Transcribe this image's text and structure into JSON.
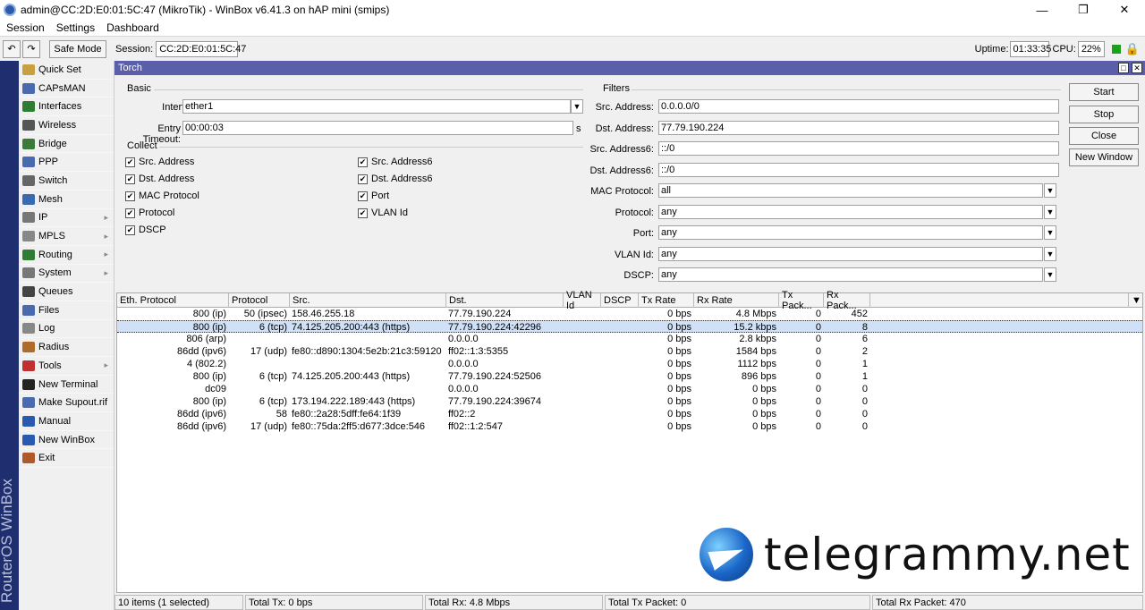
{
  "window": {
    "title": "admin@CC:2D:E0:01:5C:47 (MikroTik) - WinBox v6.41.3 on hAP mini (smips)"
  },
  "menu": [
    "Session",
    "Settings",
    "Dashboard"
  ],
  "toolbar": {
    "safe_mode": "Safe Mode",
    "session_label": "Session:",
    "session_value": "CC:2D:E0:01:5C:47",
    "uptime_label": "Uptime:",
    "uptime_value": "01:33:35",
    "cpu_label": "CPU:",
    "cpu_value": "22%"
  },
  "sidebar": {
    "brand": "RouterOS WinBox",
    "items": [
      {
        "label": "Quick Set",
        "icon": "wand-icon",
        "color": "#c8a040",
        "arrow": false
      },
      {
        "label": "CAPsMAN",
        "icon": "capsman-icon",
        "color": "#4a6ab0",
        "arrow": false
      },
      {
        "label": "Interfaces",
        "icon": "interfaces-icon",
        "color": "#2e7d32",
        "arrow": false
      },
      {
        "label": "Wireless",
        "icon": "wireless-icon",
        "color": "#555555",
        "arrow": false
      },
      {
        "label": "Bridge",
        "icon": "bridge-icon",
        "color": "#3a7a3a",
        "arrow": false
      },
      {
        "label": "PPP",
        "icon": "ppp-icon",
        "color": "#4a6ab0",
        "arrow": false
      },
      {
        "label": "Switch",
        "icon": "switch-icon",
        "color": "#666666",
        "arrow": false
      },
      {
        "label": "Mesh",
        "icon": "mesh-icon",
        "color": "#3a6ab0",
        "arrow": false
      },
      {
        "label": "IP",
        "icon": "ip-icon",
        "color": "#777777",
        "arrow": true
      },
      {
        "label": "MPLS",
        "icon": "mpls-icon",
        "color": "#888888",
        "arrow": true
      },
      {
        "label": "Routing",
        "icon": "routing-icon",
        "color": "#2e7d32",
        "arrow": true
      },
      {
        "label": "System",
        "icon": "system-icon",
        "color": "#777777",
        "arrow": true
      },
      {
        "label": "Queues",
        "icon": "queues-icon",
        "color": "#444444",
        "arrow": false
      },
      {
        "label": "Files",
        "icon": "files-icon",
        "color": "#4a6ab0",
        "arrow": false
      },
      {
        "label": "Log",
        "icon": "log-icon",
        "color": "#888888",
        "arrow": false
      },
      {
        "label": "Radius",
        "icon": "radius-icon",
        "color": "#b06a2a",
        "arrow": false
      },
      {
        "label": "Tools",
        "icon": "tools-icon",
        "color": "#c03030",
        "arrow": true
      },
      {
        "label": "New Terminal",
        "icon": "terminal-icon",
        "color": "#222222",
        "arrow": false
      },
      {
        "label": "Make Supout.rif",
        "icon": "supout-icon",
        "color": "#4a6ab0",
        "arrow": false
      },
      {
        "label": "Manual",
        "icon": "manual-icon",
        "color": "#2a5ab0",
        "arrow": false
      },
      {
        "label": "New WinBox",
        "icon": "winbox-icon",
        "color": "#2a5ab0",
        "arrow": false
      },
      {
        "label": "Exit",
        "icon": "exit-icon",
        "color": "#b05a2a",
        "arrow": false
      }
    ]
  },
  "torch": {
    "title": "Torch",
    "basic_label": "Basic",
    "interface_label": "Interface:",
    "interface_value": "ether1",
    "entry_timeout_label": "Entry Timeout:",
    "entry_timeout_value": "00:00:03",
    "entry_timeout_unit": "s",
    "collect_label": "Collect",
    "collect": [
      {
        "label": "Src. Address",
        "checked": true
      },
      {
        "label": "Dst. Address",
        "checked": true
      },
      {
        "label": "MAC Protocol",
        "checked": true
      },
      {
        "label": "Protocol",
        "checked": true
      },
      {
        "label": "DSCP",
        "checked": true
      },
      {
        "label": "Src. Address6",
        "checked": true
      },
      {
        "label": "Dst. Address6",
        "checked": true
      },
      {
        "label": "Port",
        "checked": true
      },
      {
        "label": "VLAN Id",
        "checked": true
      }
    ],
    "filters_label": "Filters",
    "filters": [
      {
        "label": "Src. Address:",
        "value": "0.0.0.0/0",
        "dropdown": false
      },
      {
        "label": "Dst. Address:",
        "value": "77.79.190.224",
        "dropdown": false
      },
      {
        "label": "Src. Address6:",
        "value": "::/0",
        "dropdown": false
      },
      {
        "label": "Dst. Address6:",
        "value": "::/0",
        "dropdown": false
      },
      {
        "label": "MAC Protocol:",
        "value": "all",
        "dropdown": true
      },
      {
        "label": "Protocol:",
        "value": "any",
        "dropdown": true
      },
      {
        "label": "Port:",
        "value": "any",
        "dropdown": true
      },
      {
        "label": "VLAN Id:",
        "value": "any",
        "dropdown": true
      },
      {
        "label": "DSCP:",
        "value": "any",
        "dropdown": true
      }
    ],
    "buttons": {
      "start": "Start",
      "stop": "Stop",
      "close": "Close",
      "new_window": "New Window"
    },
    "columns": [
      "Eth. Protocol",
      "Protocol",
      "Src.",
      "Dst.",
      "VLAN Id",
      "DSCP",
      "Tx Rate",
      "Rx Rate",
      "Tx Pack...",
      "Rx Pack..."
    ],
    "rows": [
      {
        "eth": "800 (ip)",
        "proto": "50 (ipsec)",
        "src": "158.46.255.18",
        "dst": "77.79.190.224",
        "vlan": "",
        "dscp": "",
        "tx": "0 bps",
        "rx": "4.8 Mbps",
        "txp": "0",
        "rxp": "452",
        "selected": false
      },
      {
        "eth": "800 (ip)",
        "proto": "6 (tcp)",
        "src": "74.125.205.200:443 (https)",
        "dst": "77.79.190.224:42296",
        "vlan": "",
        "dscp": "",
        "tx": "0 bps",
        "rx": "15.2 kbps",
        "txp": "0",
        "rxp": "8",
        "selected": true
      },
      {
        "eth": "806 (arp)",
        "proto": "",
        "src": "",
        "dst": "0.0.0.0",
        "vlan": "",
        "dscp": "",
        "tx": "0 bps",
        "rx": "2.8 kbps",
        "txp": "0",
        "rxp": "6",
        "selected": false
      },
      {
        "eth": "86dd (ipv6)",
        "proto": "17 (udp)",
        "src": "fe80::d890:1304:5e2b:21c3:59120",
        "dst": "ff02::1:3:5355",
        "vlan": "",
        "dscp": "",
        "tx": "0 bps",
        "rx": "1584 bps",
        "txp": "0",
        "rxp": "2",
        "selected": false
      },
      {
        "eth": "4 (802.2)",
        "proto": "",
        "src": "",
        "dst": "0.0.0.0",
        "vlan": "",
        "dscp": "",
        "tx": "0 bps",
        "rx": "1112 bps",
        "txp": "0",
        "rxp": "1",
        "selected": false
      },
      {
        "eth": "800 (ip)",
        "proto": "6 (tcp)",
        "src": "74.125.205.200:443 (https)",
        "dst": "77.79.190.224:52506",
        "vlan": "",
        "dscp": "",
        "tx": "0 bps",
        "rx": "896 bps",
        "txp": "0",
        "rxp": "1",
        "selected": false
      },
      {
        "eth": "dc09",
        "proto": "",
        "src": "",
        "dst": "0.0.0.0",
        "vlan": "",
        "dscp": "",
        "tx": "0 bps",
        "rx": "0 bps",
        "txp": "0",
        "rxp": "0",
        "selected": false
      },
      {
        "eth": "800 (ip)",
        "proto": "6 (tcp)",
        "src": "173.194.222.189:443 (https)",
        "dst": "77.79.190.224:39674",
        "vlan": "",
        "dscp": "",
        "tx": "0 bps",
        "rx": "0 bps",
        "txp": "0",
        "rxp": "0",
        "selected": false
      },
      {
        "eth": "86dd (ipv6)",
        "proto": "58",
        "src": "fe80::2a28:5dff:fe64:1f39",
        "dst": "ff02::2",
        "vlan": "",
        "dscp": "",
        "tx": "0 bps",
        "rx": "0 bps",
        "txp": "0",
        "rxp": "0",
        "selected": false
      },
      {
        "eth": "86dd (ipv6)",
        "proto": "17 (udp)",
        "src": "fe80::75da:2ff5:d677:3dce:546",
        "dst": "ff02::1:2:547",
        "vlan": "",
        "dscp": "",
        "tx": "0 bps",
        "rx": "0 bps",
        "txp": "0",
        "rxp": "0",
        "selected": false
      }
    ],
    "status": {
      "items": "10 items (1 selected)",
      "total_tx": "Total Tx: 0 bps",
      "total_rx": "Total Rx: 4.8 Mbps",
      "total_tx_packet": "Total Tx Packet: 0",
      "total_rx_packet": "Total Rx Packet: 470"
    }
  },
  "watermark": "telegrammy.net"
}
